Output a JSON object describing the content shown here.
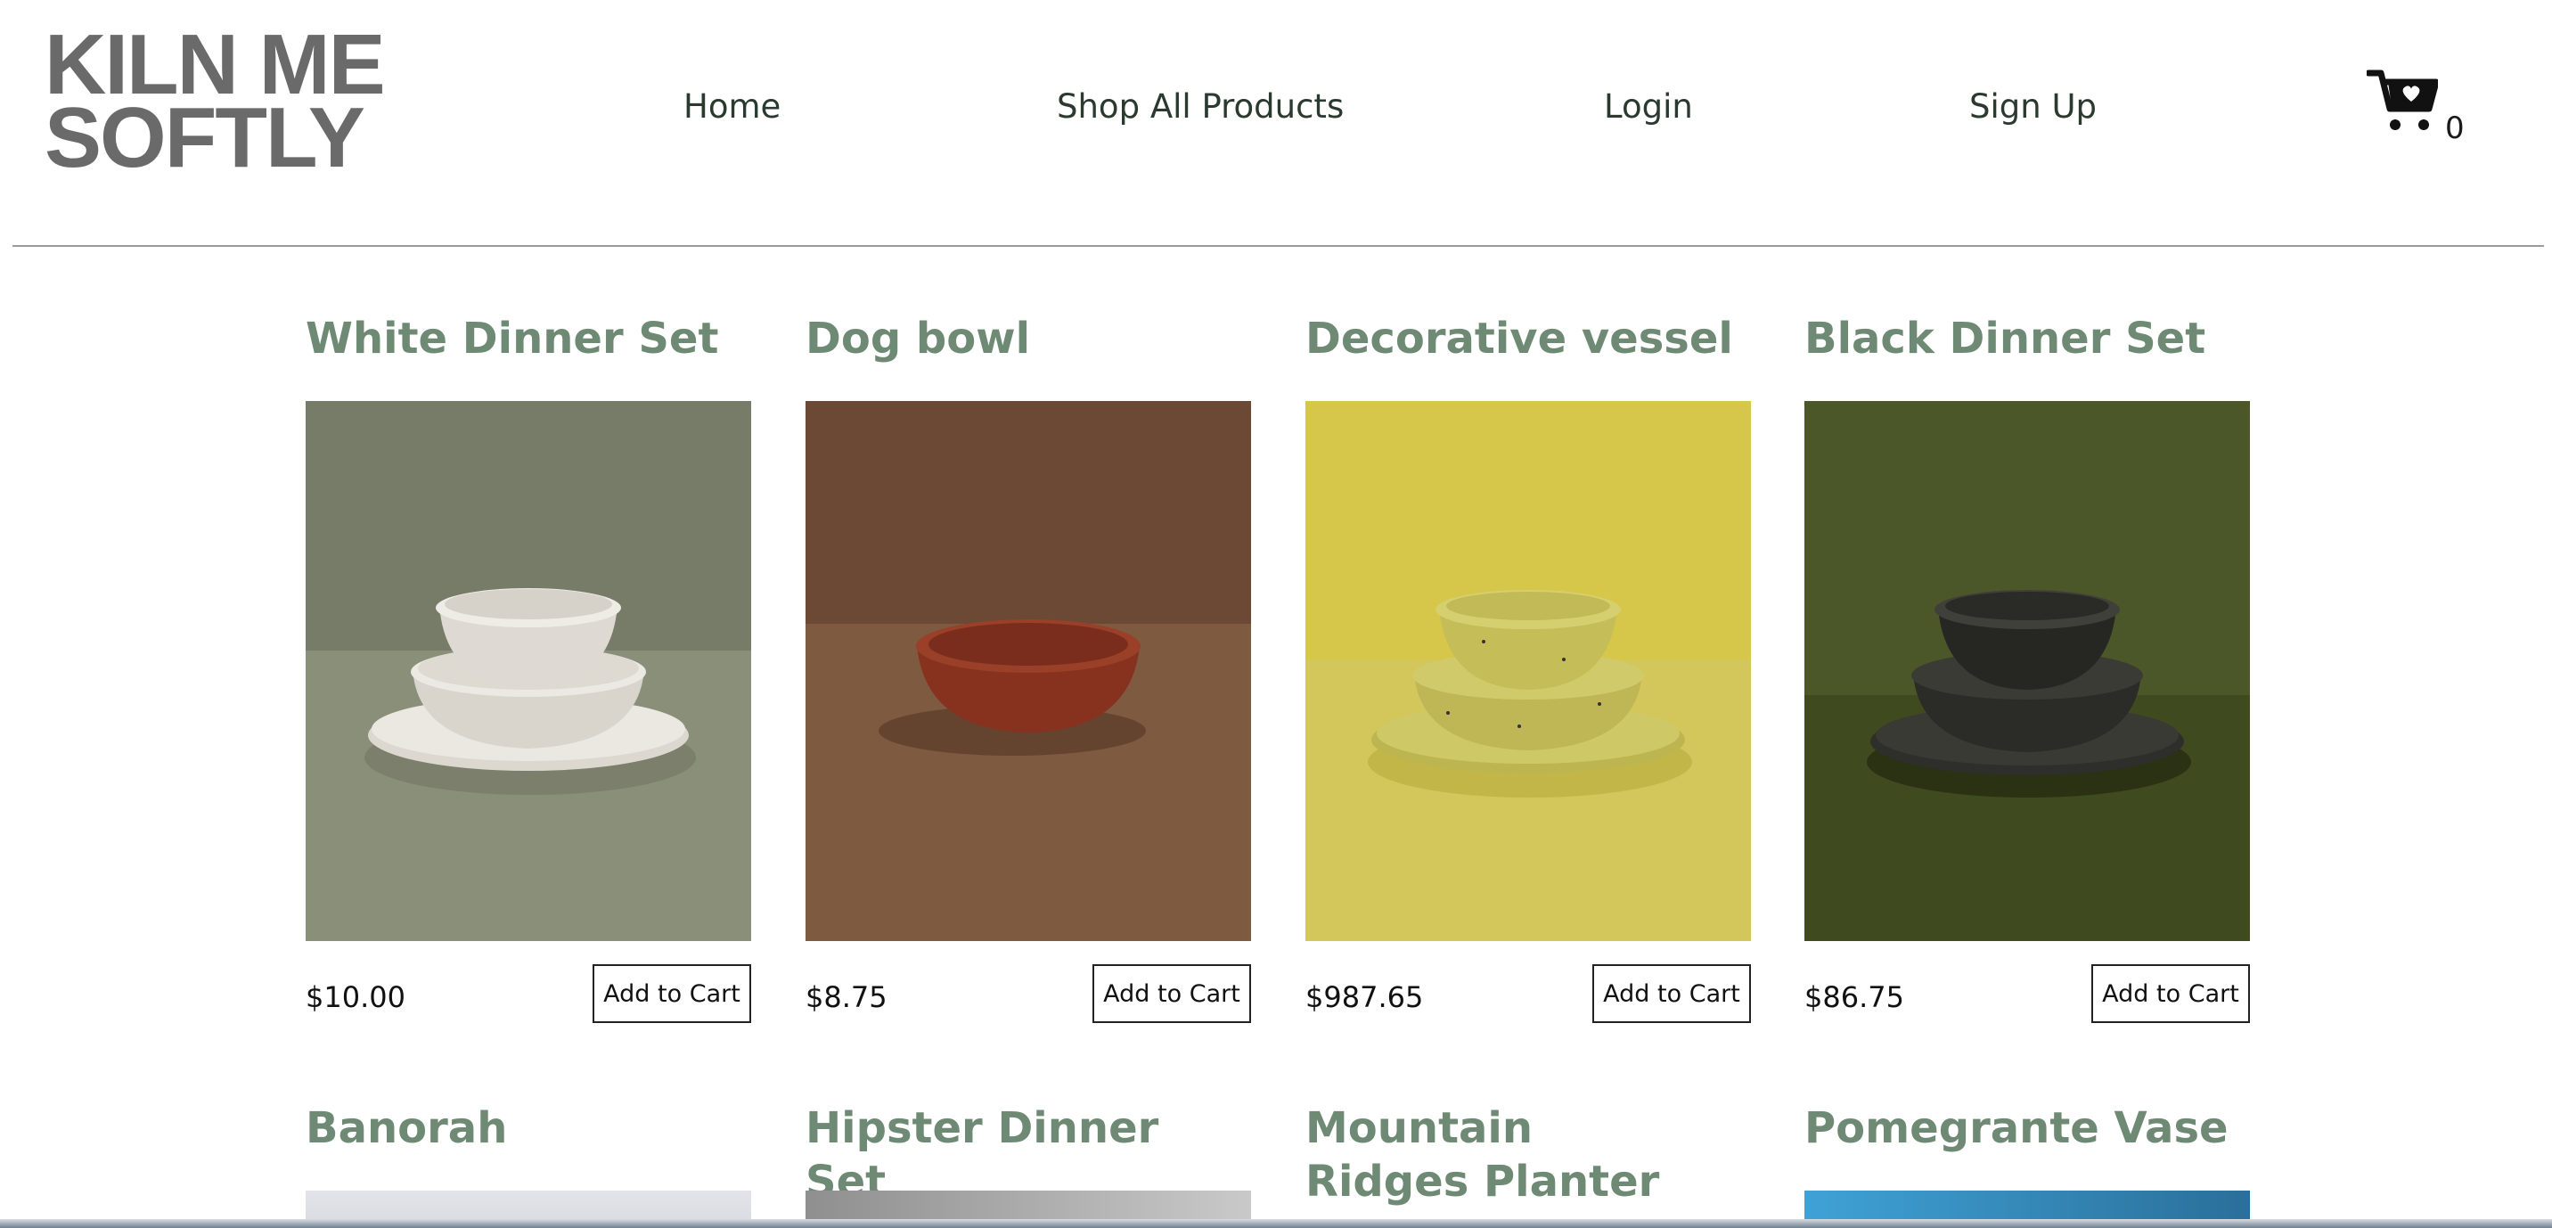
{
  "header": {
    "logo_line1": "KILN ME",
    "logo_line2": "SOFTLY",
    "nav": {
      "home": "Home",
      "shop": "Shop All Products",
      "login": "Login",
      "signup": "Sign Up"
    },
    "cart_count": "0"
  },
  "products": [
    {
      "title": "White Dinner Set",
      "price": "$10.00",
      "button": "Add to Cart",
      "image": "white-dinnerware-stack",
      "bg": "#7b806c",
      "ware": "#e3e0d8"
    },
    {
      "title": "Dog bowl",
      "price": "$8.75",
      "button": "Add to Cart",
      "image": "terracotta-bowl",
      "bg": "#6e4c37",
      "ware": "#8a3a25"
    },
    {
      "title": "Decorative vessel",
      "price": "$987.65",
      "button": "Add to Cart",
      "image": "yellow-speckled-dinnerware-stack",
      "bg": "#d4c64d",
      "ware": "#c9c05a"
    },
    {
      "title": "Black Dinner Set",
      "price": "$86.75",
      "button": "Add to Cart",
      "image": "black-dinnerware-stack",
      "bg": "#4d5a2b",
      "ware": "#2a2a26"
    }
  ],
  "products_row2": [
    {
      "title": "Banorah",
      "image": "banorah-image"
    },
    {
      "title": "Hipster Dinner Set",
      "image": "hipster-dinner-set-image"
    },
    {
      "title": "Mountain Ridges Planter",
      "image": "mountain-ridges-planter-image"
    },
    {
      "title": "Pomegrante Vase",
      "image": "pomegrante-vase-image"
    }
  ]
}
